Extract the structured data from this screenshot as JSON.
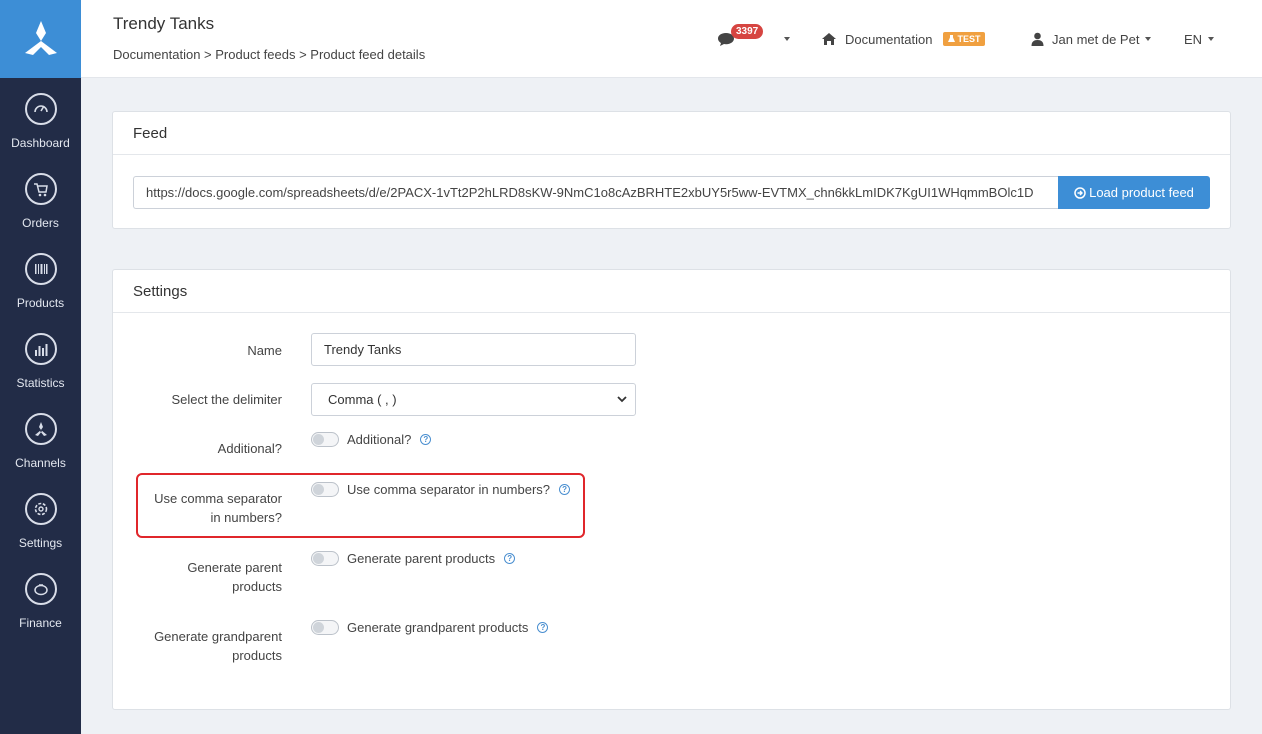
{
  "sidebar": {
    "items": [
      {
        "label": "Dashboard",
        "icon": "dashboard-icon"
      },
      {
        "label": "Orders",
        "icon": "cart-icon"
      },
      {
        "label": "Products",
        "icon": "barcode-icon"
      },
      {
        "label": "Statistics",
        "icon": "chart-icon"
      },
      {
        "label": "Channels",
        "icon": "channels-icon"
      },
      {
        "label": "Settings",
        "icon": "gear-icon"
      },
      {
        "label": "Finance",
        "icon": "piggy-bank-icon"
      }
    ]
  },
  "header": {
    "title": "Trendy Tanks",
    "breadcrumb": "Documentation > Product feeds > Product feed details",
    "notifications_count": "3397",
    "documentation_label": "Documentation",
    "test_badge": "TEST",
    "user_name": "Jan met de Pet",
    "language": "EN"
  },
  "feed": {
    "title": "Feed",
    "url": "https://docs.google.com/spreadsheets/d/e/2PACX-1vTt2P2hLRD8sKW-9NmC1o8cAzBRHTE2xbUY5r5ww-EVTMX_chn6kkLmIDK7KgUI1WHqmmBOlc1D",
    "load_button": "Load product feed"
  },
  "settings": {
    "title": "Settings",
    "name_label": "Name",
    "name_value": "Trendy Tanks",
    "delimiter_label": "Select the delimiter",
    "delimiter_value": "Comma ( , )",
    "additional_label": "Additional?",
    "additional_toggle": "Additional?",
    "comma_label_line1": "Use comma separator",
    "comma_label_line2": "in numbers?",
    "comma_toggle": "Use comma separator in numbers?",
    "parent_label_line1": "Generate parent",
    "parent_label_line2": "products",
    "parent_toggle": "Generate parent products",
    "grandparent_label_line1": "Generate grandparent",
    "grandparent_label_line2": "products",
    "grandparent_toggle": "Generate grandparent products"
  },
  "colors": {
    "sidebar": "#222c47",
    "accent": "#3d8ed6",
    "badge": "#d64541",
    "test": "#f0a040",
    "highlight": "#e0262b"
  }
}
